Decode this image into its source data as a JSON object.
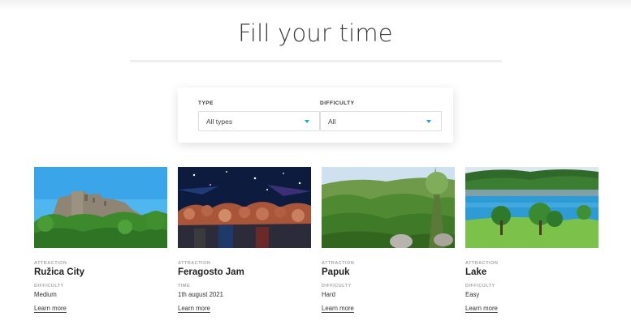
{
  "page": {
    "title": "Fill your time"
  },
  "filters": {
    "type": {
      "label": "TYPE",
      "value": "All types",
      "icon": "chevron-down-icon"
    },
    "difficulty": {
      "label": "DIFFICULTY",
      "value": "All",
      "icon": "chevron-down-icon"
    }
  },
  "colors": {
    "accent": "#1aa7c8",
    "muted_label": "#a7a7a7"
  },
  "cards": [
    {
      "kicker": "ATTRACTION",
      "title": "Ružica City",
      "sublabel": "DIFFICULTY",
      "subvalue": "Medium",
      "link": "Learn more"
    },
    {
      "kicker": "ATTRACTION",
      "title": "Feragosto Jam",
      "sublabel": "TIME",
      "subvalue": "1th august 2021",
      "link": "Learn more"
    },
    {
      "kicker": "ATTRACTION",
      "title": "Papuk",
      "sublabel": "DIFFICULTY",
      "subvalue": "Hard",
      "link": "Learn more"
    },
    {
      "kicker": "ATTRACTION",
      "title": "Lake",
      "sublabel": "DIFFICULTY",
      "subvalue": "Easy",
      "link": "Learn more"
    }
  ]
}
